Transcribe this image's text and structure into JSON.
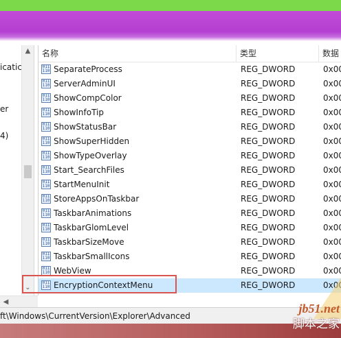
{
  "tree": {
    "items": [
      "icatic",
      "er",
      "4)"
    ]
  },
  "scrollbar": {
    "up": "▲",
    "down": "⌄",
    "left": "◀"
  },
  "list": {
    "headers": {
      "name": "名称",
      "type": "类型",
      "data": "数据"
    },
    "icon_text": "011 110",
    "rows": [
      {
        "name": "SeparateProcess",
        "type": "REG_DWORD",
        "data": "0x00"
      },
      {
        "name": "ServerAdminUI",
        "type": "REG_DWORD",
        "data": "0x00"
      },
      {
        "name": "ShowCompColor",
        "type": "REG_DWORD",
        "data": "0x00"
      },
      {
        "name": "ShowInfoTip",
        "type": "REG_DWORD",
        "data": "0x00"
      },
      {
        "name": "ShowStatusBar",
        "type": "REG_DWORD",
        "data": "0x00"
      },
      {
        "name": "ShowSuperHidden",
        "type": "REG_DWORD",
        "data": "0x00"
      },
      {
        "name": "ShowTypeOverlay",
        "type": "REG_DWORD",
        "data": "0x00"
      },
      {
        "name": "Start_SearchFiles",
        "type": "REG_DWORD",
        "data": "0x00"
      },
      {
        "name": "StartMenuInit",
        "type": "REG_DWORD",
        "data": "0x00"
      },
      {
        "name": "StoreAppsOnTaskbar",
        "type": "REG_DWORD",
        "data": "0x00"
      },
      {
        "name": "TaskbarAnimations",
        "type": "REG_DWORD",
        "data": "0x00"
      },
      {
        "name": "TaskbarGlomLevel",
        "type": "REG_DWORD",
        "data": "0x00"
      },
      {
        "name": "TaskbarSizeMove",
        "type": "REG_DWORD",
        "data": "0x00"
      },
      {
        "name": "TaskbarSmallIcons",
        "type": "REG_DWORD",
        "data": "0x00"
      },
      {
        "name": "WebView",
        "type": "REG_DWORD",
        "data": "0x00"
      },
      {
        "name": "EncryptionContextMenu",
        "type": "REG_DWORD",
        "data": "0x00"
      }
    ],
    "selected_index": 15
  },
  "status": {
    "path": "ft\\Windows\\CurrentVersion\\Explorer\\Advanced"
  },
  "watermark": {
    "logo": "jb51.net",
    "cn": "脚本之家"
  },
  "colors": {
    "highlight_box": "#d9534f",
    "selection": "#cce8ff",
    "banner": "#b43fd0"
  }
}
